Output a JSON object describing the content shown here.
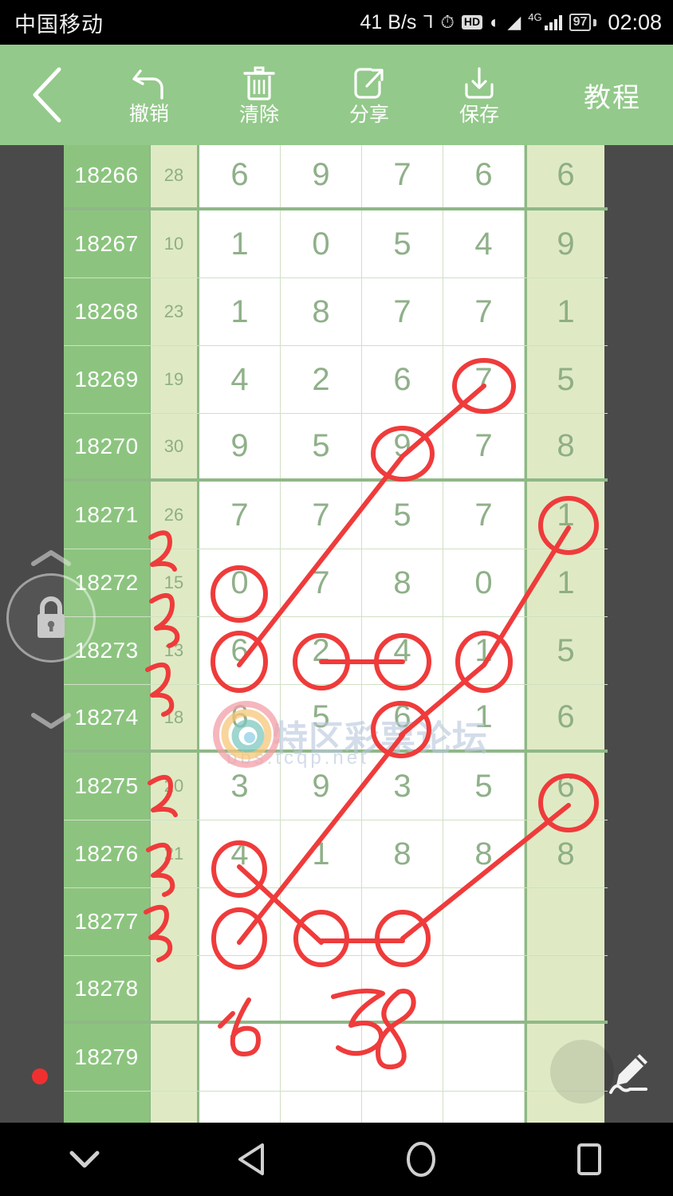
{
  "statusbar": {
    "carrier": "中国移动",
    "net_speed": "41 B/s",
    "bluetooth_icon": "bluetooth-icon",
    "alarm_icon": "alarm-icon",
    "hd_label": "HD",
    "eye_icon": "eyecare-icon",
    "wifi_icon": "wifi-icon",
    "network_type": "4G",
    "signal_icon": "signal-bars-icon",
    "battery_level": "97",
    "clock": "02:08"
  },
  "toolbar": {
    "back_icon": "chevron-left-icon",
    "items": [
      {
        "label": "撤销",
        "icon": "undo-icon"
      },
      {
        "label": "清除",
        "icon": "trash-icon"
      },
      {
        "label": "分享",
        "icon": "share-icon"
      },
      {
        "label": "保存",
        "icon": "download-icon"
      }
    ],
    "tutorial_label": "教程"
  },
  "watermark": {
    "text": "特区彩票论坛",
    "url": "bbs.tcqp.net"
  },
  "lock_control": {
    "lock_icon": "lock-icon",
    "up_icon": "chevron-up-icon",
    "down_icon": "chevron-down-icon"
  },
  "pen_fab": {
    "icon": "pen-icon"
  },
  "color_dot": {
    "color": "#f03030"
  },
  "navbar": {
    "items": [
      {
        "icon": "hide-keyboard-icon"
      },
      {
        "icon": "back-triangle-icon"
      },
      {
        "icon": "home-circle-icon"
      },
      {
        "icon": "recents-square-icon"
      }
    ]
  },
  "colors": {
    "toolbar_green": "#93c98a",
    "issue_green": "#8cc47f",
    "light_green": "#dfeac4",
    "digit_green": "#8fb089",
    "grid_line": "#8fb887",
    "ink_red": "#ef3b3b",
    "canvas_bg": "#4a4a4a"
  },
  "table": {
    "columns": [
      "issue",
      "sum",
      "d1",
      "d2",
      "d3",
      "d4",
      "last"
    ],
    "rows": [
      {
        "issue": "18266",
        "sum": "28",
        "digits": [
          "6",
          "9",
          "7",
          "6"
        ],
        "last": "6",
        "thick_bottom": true
      },
      {
        "issue": "18267",
        "sum": "10",
        "digits": [
          "1",
          "0",
          "5",
          "4"
        ],
        "last": "9",
        "thick_bottom": false
      },
      {
        "issue": "18268",
        "sum": "23",
        "digits": [
          "1",
          "8",
          "7",
          "7"
        ],
        "last": "1",
        "thick_bottom": false
      },
      {
        "issue": "18269",
        "sum": "19",
        "digits": [
          "4",
          "2",
          "6",
          "7"
        ],
        "last": "5",
        "thick_bottom": false
      },
      {
        "issue": "18270",
        "sum": "30",
        "digits": [
          "9",
          "5",
          "9",
          "7"
        ],
        "last": "8",
        "thick_bottom": true
      },
      {
        "issue": "18271",
        "sum": "26",
        "digits": [
          "7",
          "7",
          "5",
          "7"
        ],
        "last": "1",
        "thick_bottom": false
      },
      {
        "issue": "18272",
        "sum": "15",
        "digits": [
          "0",
          "7",
          "8",
          "0"
        ],
        "last": "1",
        "thick_bottom": false
      },
      {
        "issue": "18273",
        "sum": "13",
        "digits": [
          "6",
          "2",
          "4",
          "1"
        ],
        "last": "5",
        "thick_bottom": false
      },
      {
        "issue": "18274",
        "sum": "18",
        "digits": [
          "6",
          "5",
          "6",
          "1"
        ],
        "last": "6",
        "thick_bottom": true
      },
      {
        "issue": "18275",
        "sum": "20",
        "digits": [
          "3",
          "9",
          "3",
          "5"
        ],
        "last": "6",
        "thick_bottom": false
      },
      {
        "issue": "18276",
        "sum": "21",
        "digits": [
          "4",
          "1",
          "8",
          "8"
        ],
        "last": "8",
        "thick_bottom": false
      },
      {
        "issue": "18277",
        "sum": "",
        "digits": [
          "",
          "",
          "",
          ""
        ],
        "last": "",
        "thick_bottom": false
      },
      {
        "issue": "18278",
        "sum": "",
        "digits": [
          "",
          "",
          "",
          ""
        ],
        "last": "",
        "thick_bottom": true
      },
      {
        "issue": "18279",
        "sum": "",
        "digits": [
          "",
          "",
          "",
          ""
        ],
        "last": "",
        "thick_bottom": false
      },
      {
        "issue": "",
        "sum": "",
        "digits": [
          "",
          "",
          "",
          ""
        ],
        "last": "",
        "thick_bottom": false
      }
    ]
  },
  "annotations": {
    "circled_cells": [
      {
        "issue": "18269",
        "column": "d4",
        "value": "7"
      },
      {
        "issue": "18270",
        "column": "d3",
        "value": "9"
      },
      {
        "issue": "18271",
        "column": "last",
        "value": "1"
      },
      {
        "issue": "18272",
        "column": "d1",
        "value": "0"
      },
      {
        "issue": "18273",
        "column": "d1",
        "value": "6"
      },
      {
        "issue": "18273",
        "column": "d2",
        "value": "2"
      },
      {
        "issue": "18273",
        "column": "d3",
        "value": "4"
      },
      {
        "issue": "18273",
        "column": "d4",
        "value": "1"
      },
      {
        "issue": "18274",
        "column": "d3",
        "value": "6"
      },
      {
        "issue": "18275",
        "column": "last",
        "value": "6"
      },
      {
        "issue": "18276",
        "column": "d1",
        "value": "4"
      },
      {
        "issue": "18277",
        "column": "d1",
        "value": ""
      },
      {
        "issue": "18277",
        "column": "d2",
        "value": ""
      },
      {
        "issue": "18277",
        "column": "d3",
        "value": ""
      }
    ],
    "handwritten_sum_marks": [
      {
        "issue": "18271",
        "text": "2"
      },
      {
        "issue": "18272",
        "text": "3"
      },
      {
        "issue": "18273",
        "text": "3"
      },
      {
        "issue": "18275",
        "text": "2"
      },
      {
        "issue": "18276",
        "text": "3"
      },
      {
        "issue": "18277",
        "text": "3"
      }
    ],
    "handwritten_cells": [
      {
        "issue": "18278",
        "column": "d1",
        "text": "16"
      },
      {
        "issue": "18278",
        "column": "d2",
        "text": "58"
      }
    ],
    "ink_color": "#ef3b3b"
  }
}
